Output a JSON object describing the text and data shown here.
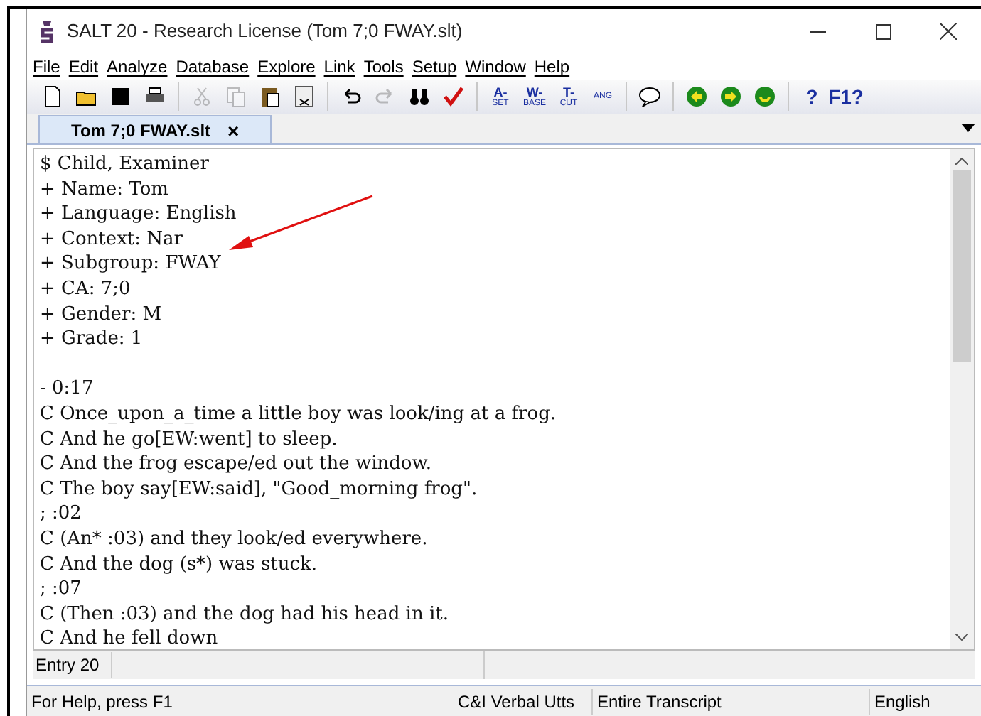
{
  "window": {
    "title": "SALT 20 - Research License (Tom 7;0 FWAY.slt)"
  },
  "menu": [
    "File",
    "Edit",
    "Analyze",
    "Database",
    "Explore",
    "Link",
    "Tools",
    "Setup",
    "Window",
    "Help"
  ],
  "toolbar": [
    {
      "kind": "new"
    },
    {
      "kind": "open"
    },
    {
      "kind": "save"
    },
    {
      "kind": "print"
    },
    {
      "kind": "sep"
    },
    {
      "kind": "cut",
      "disabled": true
    },
    {
      "kind": "copy",
      "disabled": true
    },
    {
      "kind": "paste",
      "disabled": false
    },
    {
      "kind": "doc",
      "disabled": false
    },
    {
      "kind": "sep"
    },
    {
      "kind": "undo",
      "disabled": false
    },
    {
      "kind": "redo",
      "disabled": true
    },
    {
      "kind": "find"
    },
    {
      "kind": "check"
    },
    {
      "kind": "sep"
    },
    {
      "kind": "code",
      "top": "A-",
      "bottom": "SET"
    },
    {
      "kind": "code",
      "top": "W-",
      "bottom": "BASE"
    },
    {
      "kind": "code",
      "top": "T-",
      "bottom": "CUT"
    },
    {
      "kind": "code",
      "bottom": "ANG"
    },
    {
      "kind": "sep"
    },
    {
      "kind": "bubble"
    },
    {
      "kind": "sep"
    },
    {
      "kind": "back"
    },
    {
      "kind": "forward"
    },
    {
      "kind": "refresh"
    },
    {
      "kind": "sep"
    },
    {
      "kind": "help",
      "label": "?"
    },
    {
      "kind": "help",
      "label": "F1?"
    }
  ],
  "tabs": [
    {
      "label": "Tom 7;0 FWAY.slt",
      "selected": true,
      "close": "×"
    }
  ],
  "transcript": {
    "header": [
      "$ Child, Examiner",
      "+ Name: Tom",
      "+ Language: English",
      "+ Context: Nar",
      "+ Subgroup: FWAY",
      "+ CA: 7;0",
      "+ Gender: M",
      "+ Grade: 1"
    ],
    "body": [
      "- 0:17",
      "C Once_upon_a_time a little boy was look/ing at a frog.",
      "C And he go[EW:went] to sleep.",
      "C And the frog escape/ed out the window.",
      "C The boy say[EW:said], \"Good_morning frog\".",
      "; :02",
      "C (An* :03) and they look/ed everywhere.",
      "C And the dog (s*) was stuck.",
      "; :07",
      "C (Then :03) and the dog had his head in it.",
      "C And he fell down"
    ]
  },
  "entry_bar": {
    "entry": "Entry 20"
  },
  "status_bar": [
    "For Help, press F1",
    "C&I Verbal Utts",
    "Entire Transcript",
    "English"
  ]
}
